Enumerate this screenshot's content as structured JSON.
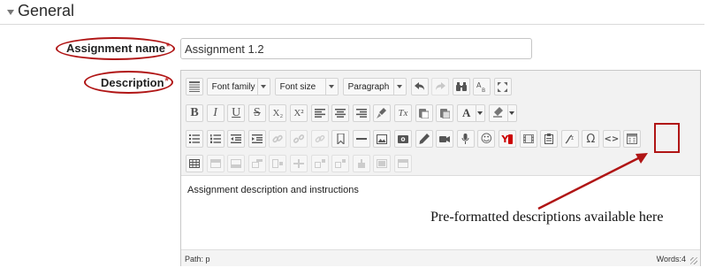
{
  "section": {
    "title": "General",
    "caret_icon": "caret-down-icon"
  },
  "assignment_name": {
    "label": "Assignment name",
    "required_marker": "*",
    "value": "Assignment 1.2"
  },
  "description": {
    "label": "Description",
    "required_marker": "*",
    "toolbar": {
      "font_family": "Font family",
      "font_size": "Font size",
      "paragraph": "Paragraph",
      "glyphs": {
        "bold": "B",
        "italic": "I",
        "underline": "U",
        "strike": "S",
        "subscript": "X₂",
        "superscript": "X²",
        "clear_format": "Tx",
        "font_color": "A",
        "emoticon": "☺",
        "youtube": "Y",
        "omega": "Ω",
        "code": "<>"
      }
    },
    "content_text": "Assignment description and instructions",
    "status_path": "Path: p",
    "status_words": "Words:4"
  },
  "annotation": {
    "note": "Pre-formatted descriptions available here",
    "highlight_color": "#b01515"
  }
}
